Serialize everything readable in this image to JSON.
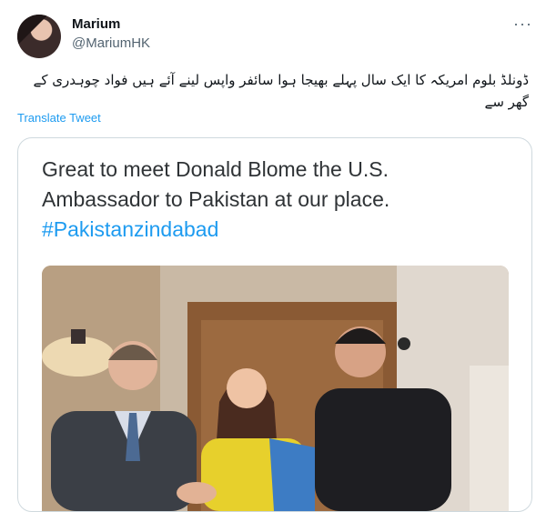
{
  "author": {
    "name": "Marium",
    "handle": "@MariumHK"
  },
  "tweet": {
    "text": "ڈونلڈ بلوم امریکہ کا ایک سال پہلے بھیجا ہوا سائفر واپس لینے آئے ہیں فواد چوہدری کے گھر سے",
    "translate_label": "Translate Tweet",
    "more_icon": "more-dots-icon"
  },
  "embedded": {
    "caption_line1": "Great to meet Donald Blome the U.S.",
    "caption_line2": "Ambassador to Pakistan at our place.",
    "hashtag": "#Pakistanzindabad"
  },
  "colors": {
    "link": "#1d9bf0",
    "secondary_text": "#536471",
    "border": "#cfd9de"
  }
}
